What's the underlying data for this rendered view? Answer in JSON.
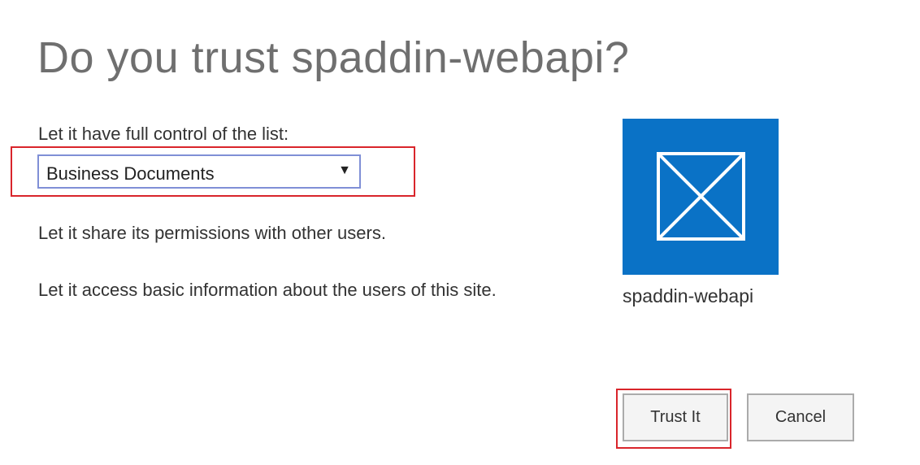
{
  "dialog": {
    "title": "Do you trust spaddin-webapi?"
  },
  "permissions": {
    "list_label": "Let it have full control of the list:",
    "list_select": {
      "selected": "Business Documents"
    },
    "share": "Let it share its permissions with other users.",
    "basic_info": "Let it access basic information about the users of this site."
  },
  "app": {
    "icon": "app-placeholder-icon",
    "name": "spaddin-webapi",
    "tile_color": "#0a72c6"
  },
  "actions": {
    "trust_label": "Trust It",
    "cancel_label": "Cancel"
  },
  "colors": {
    "highlight": "#d9252b",
    "select_border": "#7f8fd6"
  }
}
